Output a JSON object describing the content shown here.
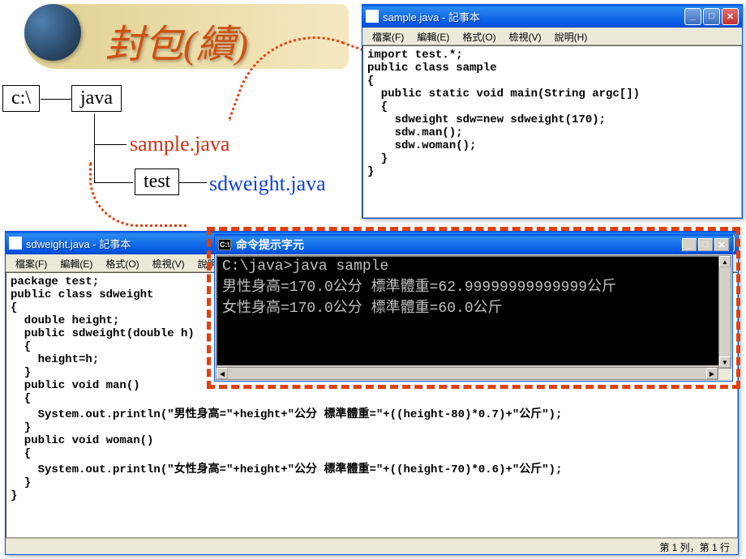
{
  "header": {
    "title": "封包(續)"
  },
  "tree": {
    "root": "c:\\",
    "java": "java",
    "sample": "sample.java",
    "test": "test",
    "sdweight": "sdweight.java"
  },
  "menus": {
    "file": "檔案(F)",
    "edit": "編輯(E)",
    "format": "格式(O)",
    "view": "檢視(V)",
    "help": "說明(H)"
  },
  "sample_window": {
    "title": "sample.java - 記事本",
    "code": "import test.*;\npublic class sample\n{\n  public static void main(String argc[])\n  {\n    sdweight sdw=new sdweight(170);\n    sdw.man();\n    sdw.woman();\n  }\n}"
  },
  "sdw_window": {
    "title": "sdweight.java - 記事本",
    "code": "package test;\npublic class sdweight\n{\n  double height;\n  public sdweight(double h)\n  {\n    height=h;\n  }\n  public void man()\n  {\n    System.out.println(\"男性身高=\"+height+\"公分 標準體重=\"+((height-80)*0.7)+\"公斤\");\n  }\n  public void woman()\n  {\n    System.out.println(\"女性身高=\"+height+\"公分 標準體重=\"+((height-70)*0.6)+\"公斤\");\n  }\n}",
    "status": "第 1 列，第 1 行"
  },
  "cmd": {
    "title": "命令提示字元",
    "icon_text": "C:\\",
    "output": "C:\\java>java sample\n男性身高=170.0公分 標準體重=62.99999999999999公斤\n女性身高=170.0公分 標準體重=60.0公斤"
  },
  "buttons": {
    "minimize": "_",
    "maximize": "□",
    "close": "✕"
  }
}
